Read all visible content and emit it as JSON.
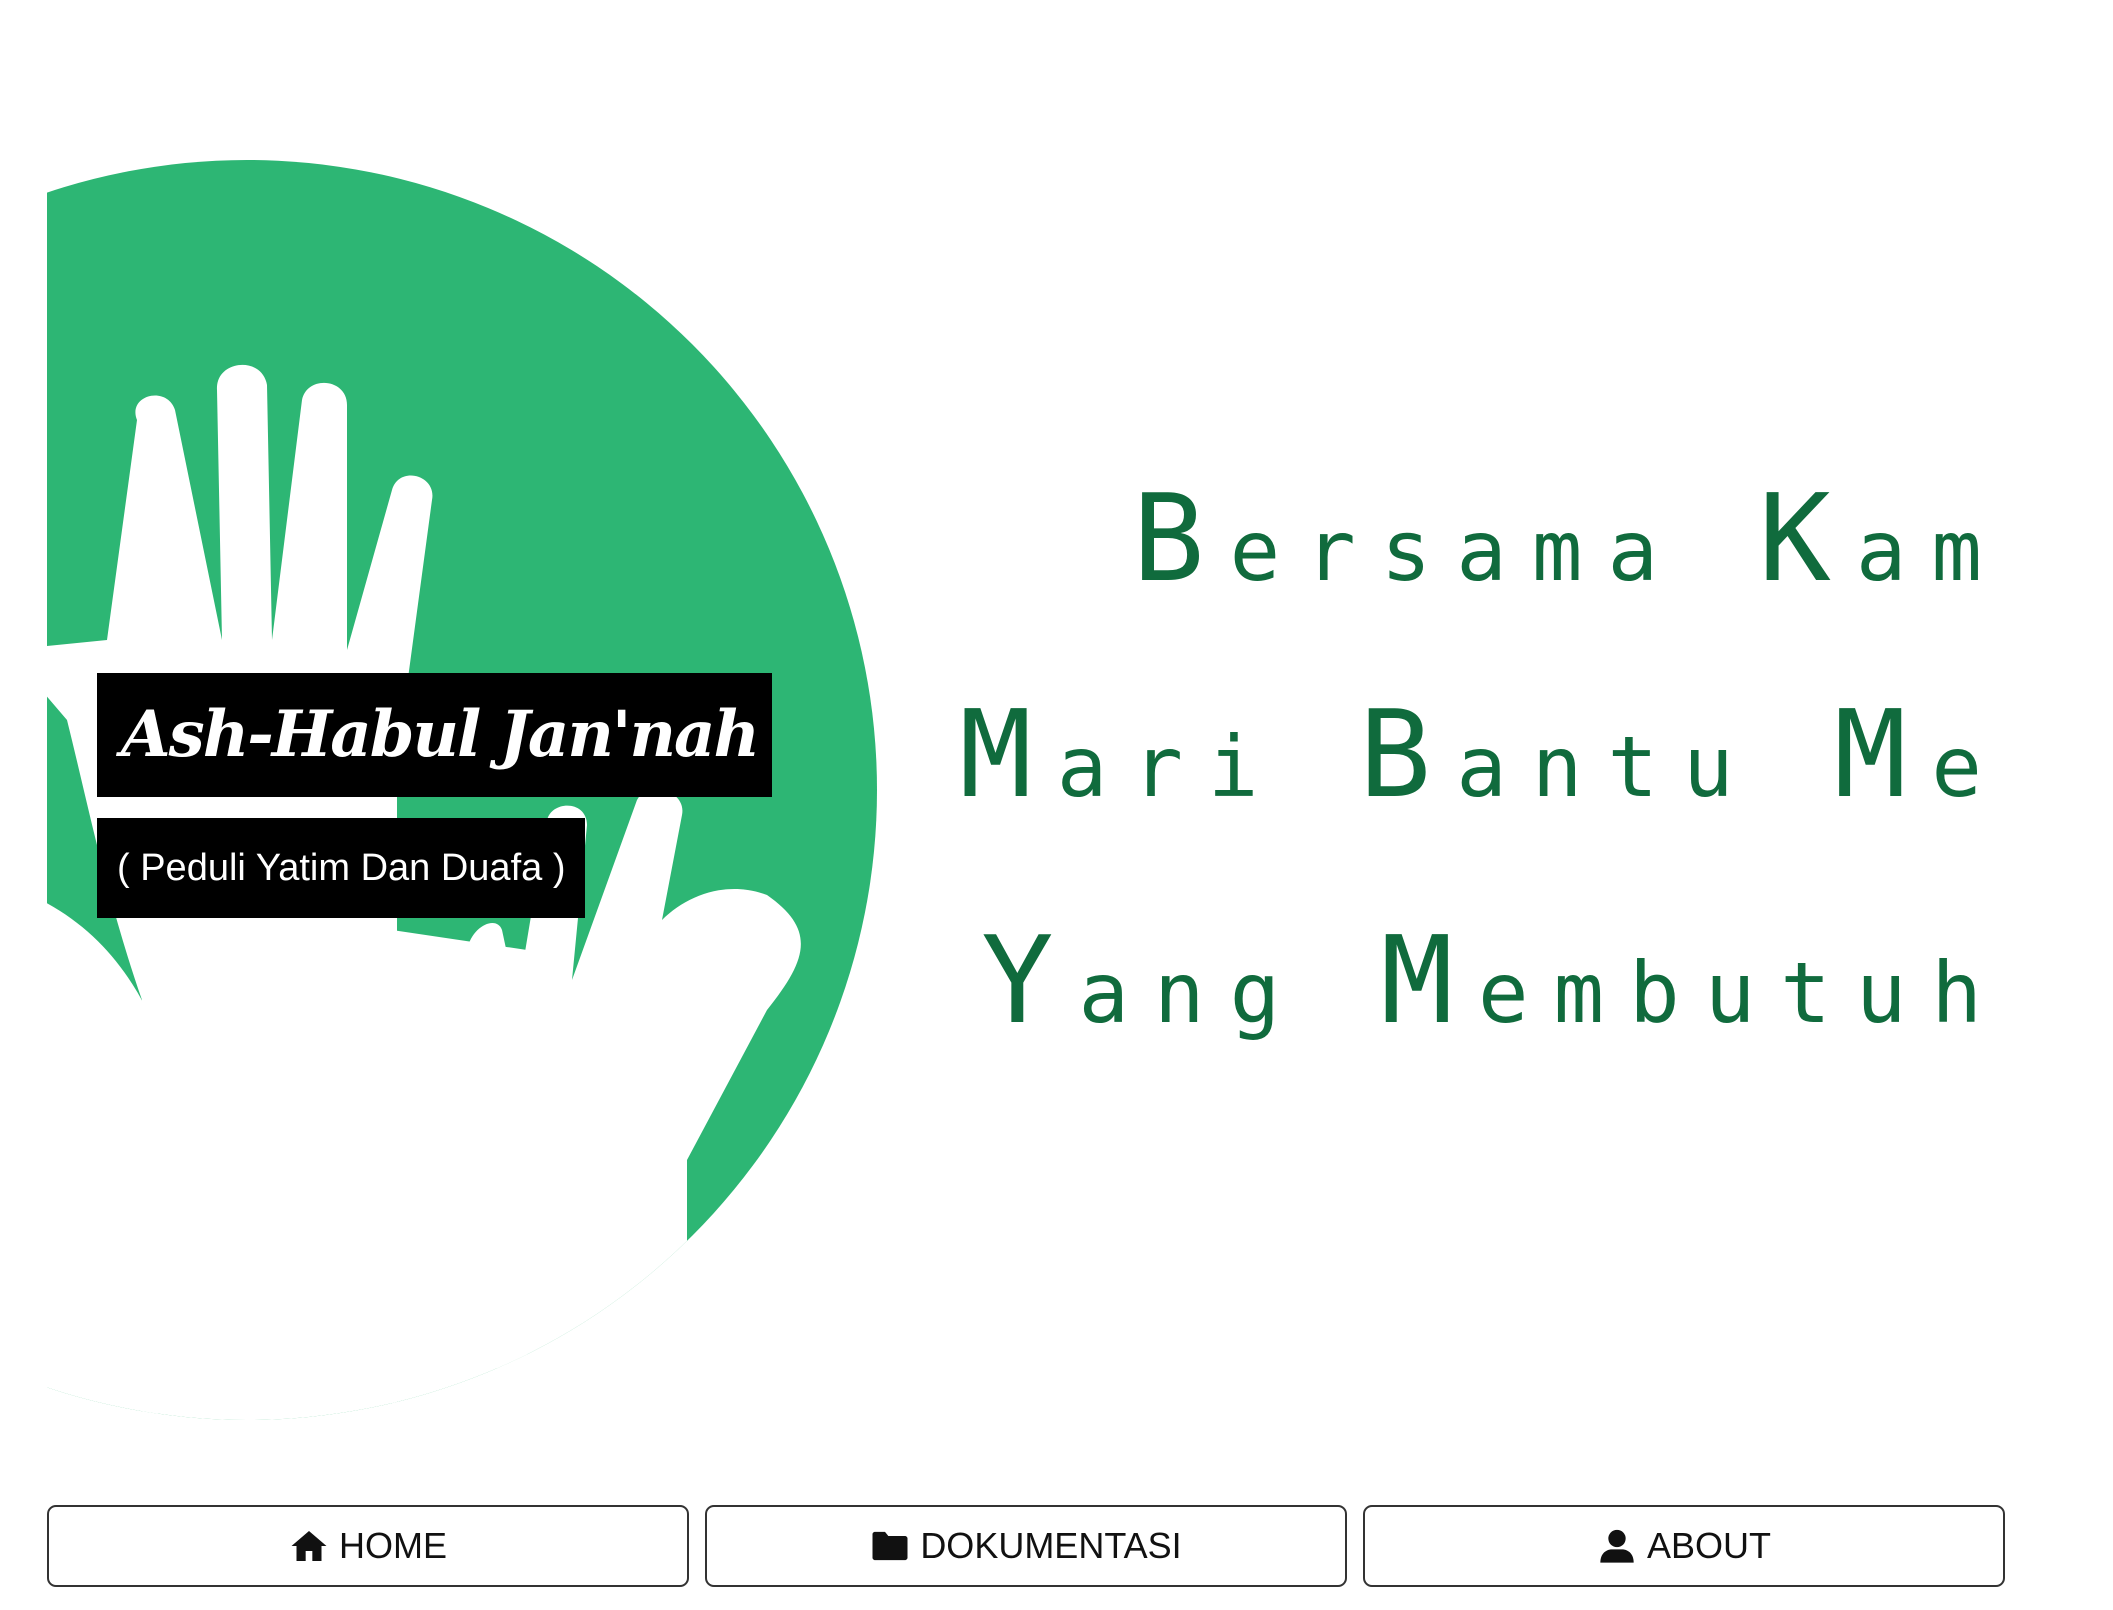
{
  "brand": {
    "title": "Ash-Habul Jan'nah",
    "subtitle": "( Peduli Yatim Dan Duafa )"
  },
  "banner": {
    "lines": [
      {
        "cap": "B",
        "rest": "ersama ",
        "cap2": "K",
        "rest2": "am"
      },
      {
        "cap": "M",
        "rest": "ari ",
        "cap2": "B",
        "rest2": "antu ",
        "cap3": "M",
        "rest3": "e"
      },
      {
        "cap": "Y",
        "rest": "ang ",
        "cap2": "M",
        "rest2": "embutuh"
      }
    ],
    "text_color": "#106b3d",
    "circle_color": "#2db674"
  },
  "nav": {
    "home_label": "HOME",
    "home_icon": "home-icon",
    "doc_label": "DOKUMENTASI",
    "doc_icon": "folder-icon",
    "about_label": "ABOUT",
    "about_icon": "user-icon"
  }
}
